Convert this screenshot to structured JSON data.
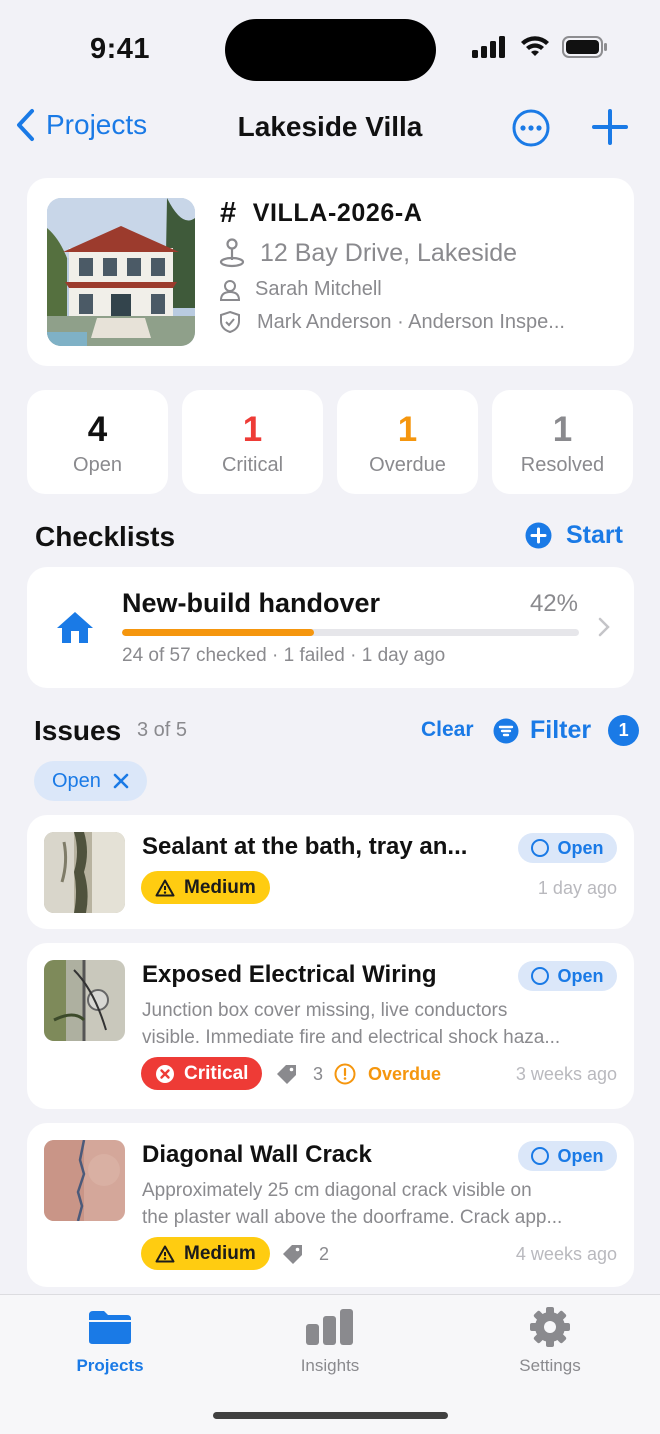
{
  "status_bar": {
    "time": "9:41"
  },
  "nav": {
    "back_label": "Projects",
    "title": "Lakeside Villa",
    "icons": [
      "chevron-left-icon",
      "ellipsis-circle-icon",
      "plus-icon"
    ]
  },
  "project": {
    "code_symbol": "#",
    "code": "VILLA-2026-A",
    "address": "12 Bay Drive, Lakeside",
    "owner": "Sarah Mitchell",
    "inspector": "Mark Anderson · Anderson Inspe..."
  },
  "stats": [
    {
      "value": "4",
      "label": "Open",
      "color": "#111111"
    },
    {
      "value": "1",
      "label": "Critical",
      "color": "#ee3b36"
    },
    {
      "value": "1",
      "label": "Overdue",
      "color": "#f5960e"
    },
    {
      "value": "1",
      "label": "Resolved",
      "color": "#8a8a8e"
    }
  ],
  "checklists": {
    "title": "Checklists",
    "start_label": "Start",
    "item": {
      "name": "New-build handover",
      "percent_label": "42%",
      "progress": 0.42,
      "meta": "24 of 57 checked · 1 failed · 1 day ago"
    }
  },
  "issues": {
    "title": "Issues",
    "count": "3 of 5",
    "clear_label": "Clear",
    "filter_label": "Filter",
    "filter_count": "1",
    "active_chip": "Open",
    "items": [
      {
        "title": "Sealant at the bath, tray an...",
        "status": "Open",
        "severity": "Medium",
        "time": "1 day ago"
      },
      {
        "title": "Exposed Electrical Wiring",
        "status": "Open",
        "desc1": "Junction box cover missing, live conductors",
        "desc2": "visible. Immediate fire and electrical shock haza...",
        "severity": "Critical",
        "tags": "3",
        "overdue": "Overdue",
        "time": "3 weeks ago"
      },
      {
        "title": "Diagonal Wall Crack",
        "status": "Open",
        "desc1": "Approximately 25 cm diagonal crack visible on",
        "desc2": "the plaster wall above the doorframe. Crack app...",
        "severity": "Medium",
        "tags": "2",
        "time": "4 weeks ago"
      }
    ]
  },
  "tabs": [
    {
      "label": "Projects",
      "icon": "folder-icon",
      "active": true
    },
    {
      "label": "Insights",
      "icon": "bar-chart-icon",
      "active": false
    },
    {
      "label": "Settings",
      "icon": "gear-icon",
      "active": false
    }
  ],
  "colors": {
    "accent": "#1a7ae6",
    "critical": "#ee3b36",
    "warning": "#f5960e",
    "medium": "#ffcc11"
  }
}
